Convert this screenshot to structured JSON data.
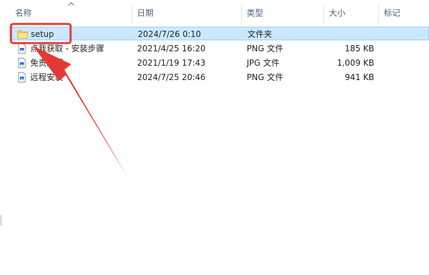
{
  "columns": {
    "name": "名称",
    "date": "日期",
    "type": "类型",
    "size": "大小",
    "tags": "标记"
  },
  "files": [
    {
      "name": "setup",
      "date": "2024/7/26 0:10",
      "type": "文件夹",
      "size": "",
      "icon": "folder-icon",
      "selected": true
    },
    {
      "name": "点我获取 - 安装步骤",
      "date": "2021/4/25 16:20",
      "type": "PNG 文件",
      "size": "185 KB",
      "icon": "image-file-icon"
    },
    {
      "name": "免责声明",
      "date": "2021/1/19 17:43",
      "type": "JPG 文件",
      "size": "1,009 KB",
      "icon": "image-file-icon"
    },
    {
      "name": "远程安装",
      "date": "2024/7/25 20:46",
      "type": "PNG 文件",
      "size": "941 KB",
      "icon": "image-file-icon"
    }
  ],
  "colors": {
    "selection": "#cce8ff",
    "annotation": "#e53935"
  }
}
